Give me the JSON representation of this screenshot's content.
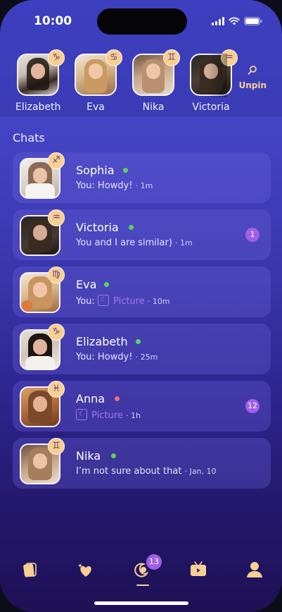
{
  "status": {
    "time": "10:00"
  },
  "pinned": {
    "unpin_label": "Unpin",
    "items": [
      {
        "name": "Elizabeth",
        "zodiac": "♑"
      },
      {
        "name": "Eva",
        "zodiac": "♋"
      },
      {
        "name": "Nika",
        "zodiac": "♊"
      },
      {
        "name": "Victoria",
        "zodiac": "♒"
      }
    ]
  },
  "chats": {
    "title": "Chats",
    "items": [
      {
        "name": "Sophia",
        "zodiac": "♐",
        "status": "online",
        "preview": "You: Howdy!",
        "time": "· 1m",
        "badge": ""
      },
      {
        "name": "Victoria",
        "zodiac": "♒",
        "status": "online",
        "preview": "You and I are similar)",
        "time": "· 1m",
        "badge": "1"
      },
      {
        "name": "Eva",
        "zodiac": "♍",
        "status": "online",
        "preview_prefix": "You:",
        "preview_tag": "Picture",
        "time": "· 10m",
        "badge": ""
      },
      {
        "name": "Elizabeth",
        "zodiac": "♑",
        "status": "online",
        "preview": "You: Howdy!",
        "time": "· 25m",
        "badge": ""
      },
      {
        "name": "Anna",
        "zodiac": "♓",
        "status": "away",
        "preview_tag": "Picture",
        "time": "· 1h",
        "badge": "12"
      },
      {
        "name": "Nika",
        "zodiac": "♊",
        "status": "online",
        "preview": "I’m not sure about that",
        "time": "· Jan, 10",
        "badge": ""
      }
    ]
  },
  "tabbar": {
    "chat_badge": "13"
  },
  "colors": {
    "online": "#5fd05a",
    "away": "#f06a86",
    "accent": "#f8cf92",
    "badge": "#a35fe8"
  }
}
